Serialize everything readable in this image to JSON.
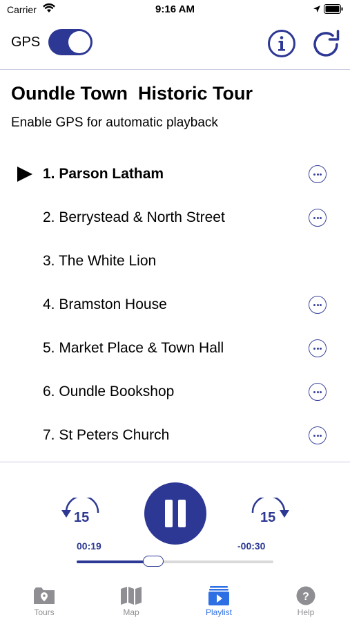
{
  "status_bar": {
    "carrier": "Carrier",
    "time": "9:16 AM"
  },
  "header": {
    "gps_label": "GPS",
    "gps_enabled": true,
    "info_icon": "info-circle-icon",
    "refresh_icon": "refresh-icon"
  },
  "title": "Oundle Town  Historic Tour",
  "subtitle": "Enable GPS for automatic playback",
  "playlist": {
    "items": [
      {
        "label": "1. Parson Latham",
        "active": true,
        "has_more": true
      },
      {
        "label": "2. Berrystead & North Street",
        "active": false,
        "has_more": true
      },
      {
        "label": "3. The White Lion",
        "active": false,
        "has_more": false
      },
      {
        "label": "4. Bramston House",
        "active": false,
        "has_more": true
      },
      {
        "label": "5. Market Place & Town Hall",
        "active": false,
        "has_more": true
      },
      {
        "label": "6. Oundle Bookshop",
        "active": false,
        "has_more": true
      },
      {
        "label": "7. St Peters Church",
        "active": false,
        "has_more": true
      }
    ]
  },
  "player": {
    "skip_back": "15",
    "skip_forward": "15",
    "elapsed": "00:19",
    "remaining": "-00:30",
    "progress": 0.39,
    "state": "playing"
  },
  "tabs": [
    {
      "label": "Tours",
      "icon": "tours-icon",
      "active": false
    },
    {
      "label": "Map",
      "icon": "map-icon",
      "active": false
    },
    {
      "label": "Playlist",
      "icon": "playlist-icon",
      "active": true
    },
    {
      "label": "Help",
      "icon": "help-icon",
      "active": false
    }
  ],
  "colors": {
    "accent": "#2d3894",
    "tab_active": "#2f6fe4",
    "tab_inactive": "#8e8e93"
  }
}
